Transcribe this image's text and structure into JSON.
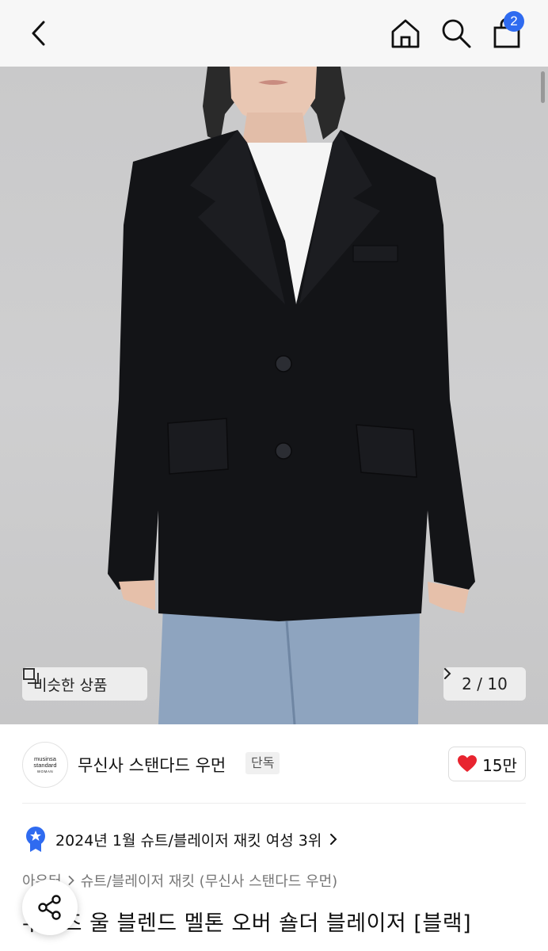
{
  "header": {
    "cart_badge": "2"
  },
  "gallery": {
    "similar_label": "비슷한 상품",
    "current_page": "2",
    "separator": "/",
    "total_pages": "10",
    "colors": {
      "jacket": "#131417",
      "shirt": "#f5f5f5",
      "jeans": "#8ea4bf",
      "background": "#cbcbcc"
    }
  },
  "brand": {
    "logo_line1": "musinsa",
    "logo_line2": "standard",
    "logo_line3": "WOMAN",
    "name": "무신사 스탠다드 우먼",
    "badge": "단독",
    "likes": "15만"
  },
  "ranking": {
    "text": "2024년 1월 슈트/블레이저 재킷 여성 3위"
  },
  "breadcrumb": {
    "category": "아우터",
    "subcategory": "슈트/블레이저 재킷 (무신사 스탠다드 우먼)"
  },
  "product": {
    "title": "우먼즈 울 블렌드 멜톤 오버 숄더 블레이저 [블랙]"
  },
  "accent_colors": {
    "cart_badge": "#2f6bf0",
    "heart": "#e8242f",
    "rank_badge": "#2f6bf0"
  }
}
